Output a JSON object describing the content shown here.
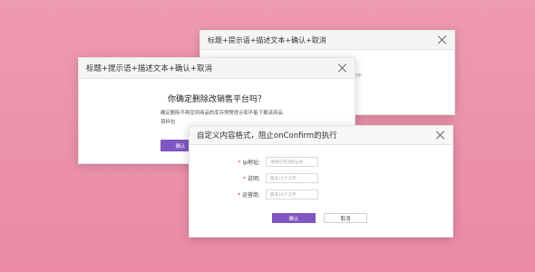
{
  "back_dialog": {
    "title": "标题+提示语+描述文本+确认+取消",
    "peek_text": "如不"
  },
  "middle_dialog": {
    "title": "标题+提示语+描述文本+确认+取消",
    "question": "你确定删除改销售平台吗？",
    "description": "确定删除不再受到商品的库存预警提示和不能下载该商品资料包",
    "confirm_label": "确认"
  },
  "front_dialog": {
    "title": "自定义内容格式，阻止onConfirm的执行",
    "fields": [
      {
        "label": "ip地址:",
        "placeholder": "请填写有效的ip地"
      },
      {
        "label": "说明:",
        "placeholder": "最多15个汉字"
      },
      {
        "label": "运营商:",
        "placeholder": "最多10个汉字"
      }
    ],
    "required_mark": "*",
    "confirm_label": "确认",
    "cancel_label": "取消"
  },
  "colors": {
    "background": "#ec90ab",
    "primary_button": "#7e57c2",
    "required": "#e53935"
  },
  "icons": {
    "close": "close-icon"
  }
}
